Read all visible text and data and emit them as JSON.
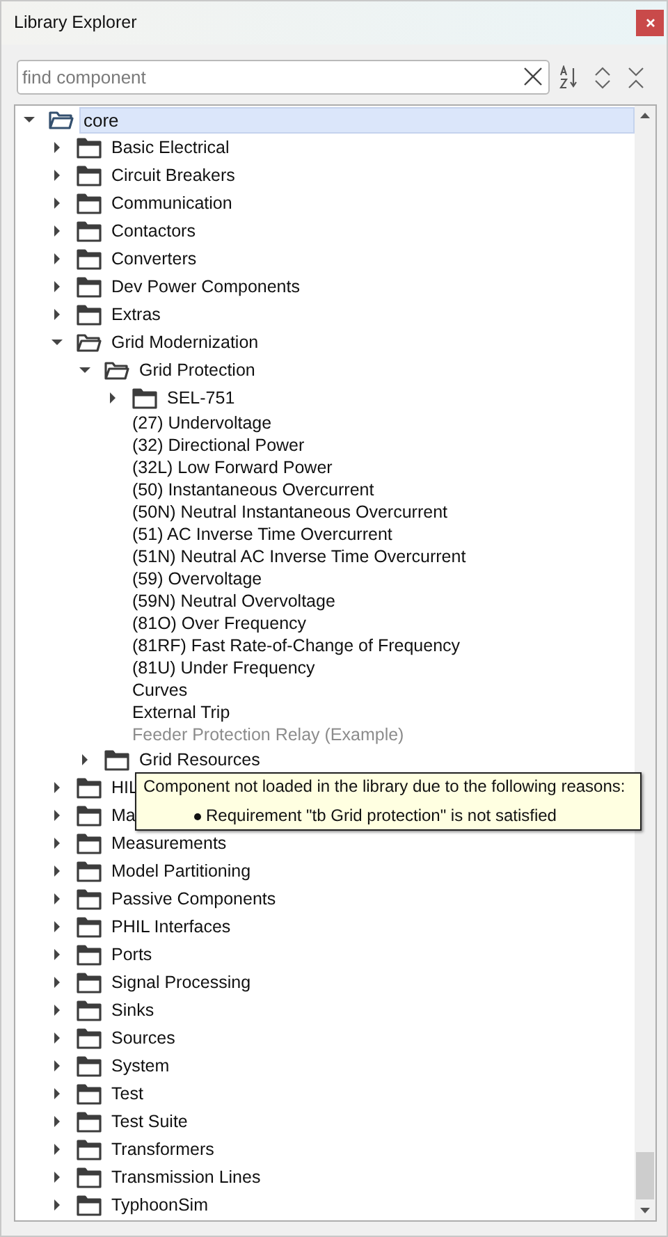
{
  "window": {
    "title": "Library Explorer"
  },
  "search": {
    "placeholder": "find component"
  },
  "tree": [
    {
      "kind": "folder",
      "label": "core",
      "expanded": true,
      "selected": true,
      "children": [
        {
          "kind": "folder",
          "label": "Basic Electrical",
          "expanded": false,
          "selected": false
        },
        {
          "kind": "folder",
          "label": "Circuit Breakers",
          "expanded": false,
          "selected": false
        },
        {
          "kind": "folder",
          "label": "Communication",
          "expanded": false,
          "selected": false
        },
        {
          "kind": "folder",
          "label": "Contactors",
          "expanded": false,
          "selected": false
        },
        {
          "kind": "folder",
          "label": "Converters",
          "expanded": false,
          "selected": false
        },
        {
          "kind": "folder",
          "label": "Dev Power Components",
          "expanded": false,
          "selected": false
        },
        {
          "kind": "folder",
          "label": "Extras",
          "expanded": false,
          "selected": false
        },
        {
          "kind": "folder",
          "label": "Grid Modernization",
          "expanded": true,
          "selected": false,
          "children": [
            {
              "kind": "folder",
              "label": "Grid Protection",
              "expanded": true,
              "selected": false,
              "children": [
                {
                  "kind": "folder",
                  "label": "SEL-751",
                  "expanded": false,
                  "selected": false
                },
                {
                  "kind": "leaf",
                  "label": "(27) Undervoltage",
                  "disabled": false,
                  "selected": false
                },
                {
                  "kind": "leaf",
                  "label": "(32) Directional Power",
                  "disabled": false,
                  "selected": false
                },
                {
                  "kind": "leaf",
                  "label": "(32L) Low Forward Power",
                  "disabled": false,
                  "selected": false
                },
                {
                  "kind": "leaf",
                  "label": "(50) Instantaneous Overcurrent",
                  "disabled": false,
                  "selected": false
                },
                {
                  "kind": "leaf",
                  "label": "(50N) Neutral Instantaneous Overcurrent",
                  "disabled": false,
                  "selected": false
                },
                {
                  "kind": "leaf",
                  "label": "(51) AC Inverse Time Overcurrent",
                  "disabled": false,
                  "selected": false
                },
                {
                  "kind": "leaf",
                  "label": "(51N) Neutral AC Inverse Time Overcurrent",
                  "disabled": false,
                  "selected": false
                },
                {
                  "kind": "leaf",
                  "label": "(59) Overvoltage",
                  "disabled": false,
                  "selected": false
                },
                {
                  "kind": "leaf",
                  "label": "(59N) Neutral Overvoltage",
                  "disabled": false,
                  "selected": false
                },
                {
                  "kind": "leaf",
                  "label": "(81O) Over Frequency",
                  "disabled": false,
                  "selected": false
                },
                {
                  "kind": "leaf",
                  "label": "(81RF) Fast Rate-of-Change of Frequency",
                  "disabled": false,
                  "selected": false
                },
                {
                  "kind": "leaf",
                  "label": "(81U) Under Frequency",
                  "disabled": false,
                  "selected": false
                },
                {
                  "kind": "leaf",
                  "label": "Curves",
                  "disabled": false,
                  "selected": false
                },
                {
                  "kind": "leaf",
                  "label": "External Trip",
                  "disabled": false,
                  "selected": false
                },
                {
                  "kind": "leaf",
                  "label": "Feeder Protection Relay (Example)",
                  "disabled": true,
                  "selected": false
                }
              ]
            },
            {
              "kind": "folder",
              "label": "Grid Resources",
              "expanded": false,
              "selected": false
            }
          ]
        },
        {
          "kind": "folder",
          "label": "HIL",
          "expanded": false,
          "selected": false
        },
        {
          "kind": "folder",
          "label": "Ma",
          "expanded": false,
          "selected": false
        },
        {
          "kind": "folder",
          "label": "Measurements",
          "expanded": false,
          "selected": false
        },
        {
          "kind": "folder",
          "label": "Model Partitioning",
          "expanded": false,
          "selected": false
        },
        {
          "kind": "folder",
          "label": "Passive Components",
          "expanded": false,
          "selected": false
        },
        {
          "kind": "folder",
          "label": "PHIL Interfaces",
          "expanded": false,
          "selected": false
        },
        {
          "kind": "folder",
          "label": "Ports",
          "expanded": false,
          "selected": false
        },
        {
          "kind": "folder",
          "label": "Signal Processing",
          "expanded": false,
          "selected": false
        },
        {
          "kind": "folder",
          "label": "Sinks",
          "expanded": false,
          "selected": false
        },
        {
          "kind": "folder",
          "label": "Sources",
          "expanded": false,
          "selected": false
        },
        {
          "kind": "folder",
          "label": "System",
          "expanded": false,
          "selected": false
        },
        {
          "kind": "folder",
          "label": "Test",
          "expanded": false,
          "selected": false
        },
        {
          "kind": "folder",
          "label": "Test Suite",
          "expanded": false,
          "selected": false
        },
        {
          "kind": "folder",
          "label": "Transformers",
          "expanded": false,
          "selected": false
        },
        {
          "kind": "folder",
          "label": "Transmission Lines",
          "expanded": false,
          "selected": false
        },
        {
          "kind": "folder",
          "label": "TyphoonSim",
          "expanded": false,
          "selected": false
        }
      ]
    }
  ],
  "tooltip": {
    "message": "Component not loaded in the library due to the following reasons:",
    "reasons": [
      "Requirement \"tb Grid protection\" is not satisfied"
    ]
  }
}
